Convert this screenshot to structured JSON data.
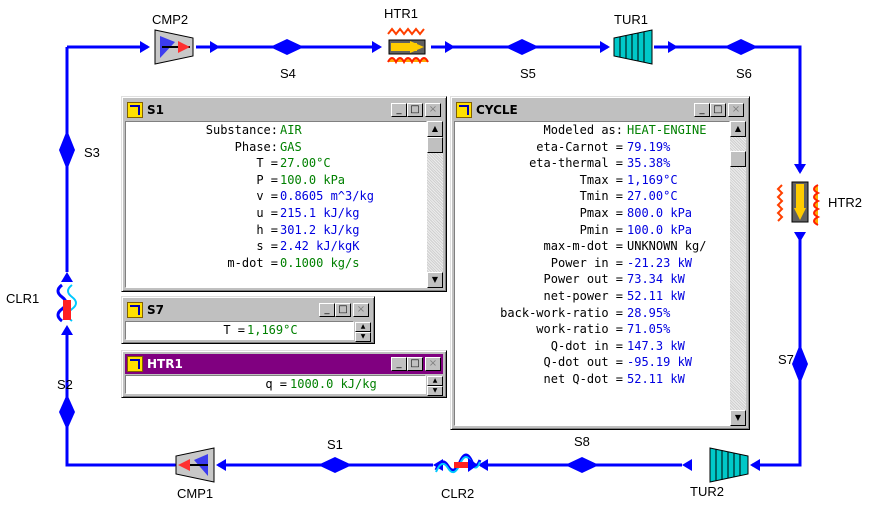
{
  "labels": {
    "cmp2": "CMP2",
    "htr1": "HTR1",
    "tur1": "TUR1",
    "htr2": "HTR2",
    "tur2": "TUR2",
    "clr2": "CLR2",
    "cmp1": "CMP1",
    "clr1": "CLR1",
    "s1": "S1",
    "s2": "S2",
    "s3": "S3",
    "s4": "S4",
    "s5": "S5",
    "s6": "S6",
    "s7": "S7",
    "s8": "S8"
  },
  "colors": {
    "pipe": "#0000ff",
    "green_text": "#008000",
    "blue_text": "#0000e0",
    "titlebar_active": "#800080"
  },
  "win_s1": {
    "title": "S1",
    "rows": [
      {
        "k": "Substance:",
        "v": "AIR",
        "green": true
      },
      {
        "k": "Phase:",
        "v": "GAS",
        "green": true
      },
      {
        "k": "T =",
        "v": "27.00°C",
        "green": true
      },
      {
        "k": "P =",
        "v": "100.0 kPa",
        "green": true
      },
      {
        "k": "v =",
        "v": "0.8605 m^3/kg",
        "green": false
      },
      {
        "k": "u =",
        "v": "215.1 kJ/kg",
        "green": false
      },
      {
        "k": "h =",
        "v": "301.2 kJ/kg",
        "green": false
      },
      {
        "k": "s =",
        "v": "2.42 kJ/kgK",
        "green": false
      },
      {
        "k": "m-dot =",
        "v": "0.1000 kg/s",
        "green": true
      }
    ]
  },
  "win_s7": {
    "title": "S7",
    "k": "T =",
    "v": "1,169°C"
  },
  "win_htr1": {
    "title": "HTR1",
    "k": "q =",
    "v": "1000.0 kJ/kg"
  },
  "win_cycle": {
    "title": "CYCLE",
    "rows": [
      {
        "k": "Modeled as:",
        "v": "HEAT-ENGINE",
        "green": true
      },
      {
        "k": "eta-Carnot =",
        "v": "79.19%",
        "green": false
      },
      {
        "k": "eta-thermal =",
        "v": "35.38%",
        "green": false
      },
      {
        "k": "Tmax =",
        "v": "1,169°C",
        "green": false
      },
      {
        "k": "Tmin =",
        "v": "27.00°C",
        "green": false
      },
      {
        "k": "Pmax =",
        "v": "800.0 kPa",
        "green": false
      },
      {
        "k": "Pmin =",
        "v": "100.0 kPa",
        "green": false
      },
      {
        "k": "max-m-dot =",
        "v": "UNKNOWN kg/",
        "green": false,
        "black": true
      },
      {
        "k": "Power in =",
        "v": "-21.23 kW",
        "green": false
      },
      {
        "k": "Power out =",
        "v": "73.34 kW",
        "green": false
      },
      {
        "k": "net-power =",
        "v": "52.11 kW",
        "green": false
      },
      {
        "k": "back-work-ratio =",
        "v": "28.95%",
        "green": false
      },
      {
        "k": "work-ratio =",
        "v": "71.05%",
        "green": false
      },
      {
        "k": "Q-dot in =",
        "v": "147.3 kW",
        "green": false
      },
      {
        "k": "Q-dot out =",
        "v": "-95.19 kW",
        "green": false
      },
      {
        "k": "net Q-dot =",
        "v": "52.11 kW",
        "green": false
      }
    ]
  },
  "buttons": {
    "minimize": "_",
    "maximize": "□",
    "close": "×"
  }
}
